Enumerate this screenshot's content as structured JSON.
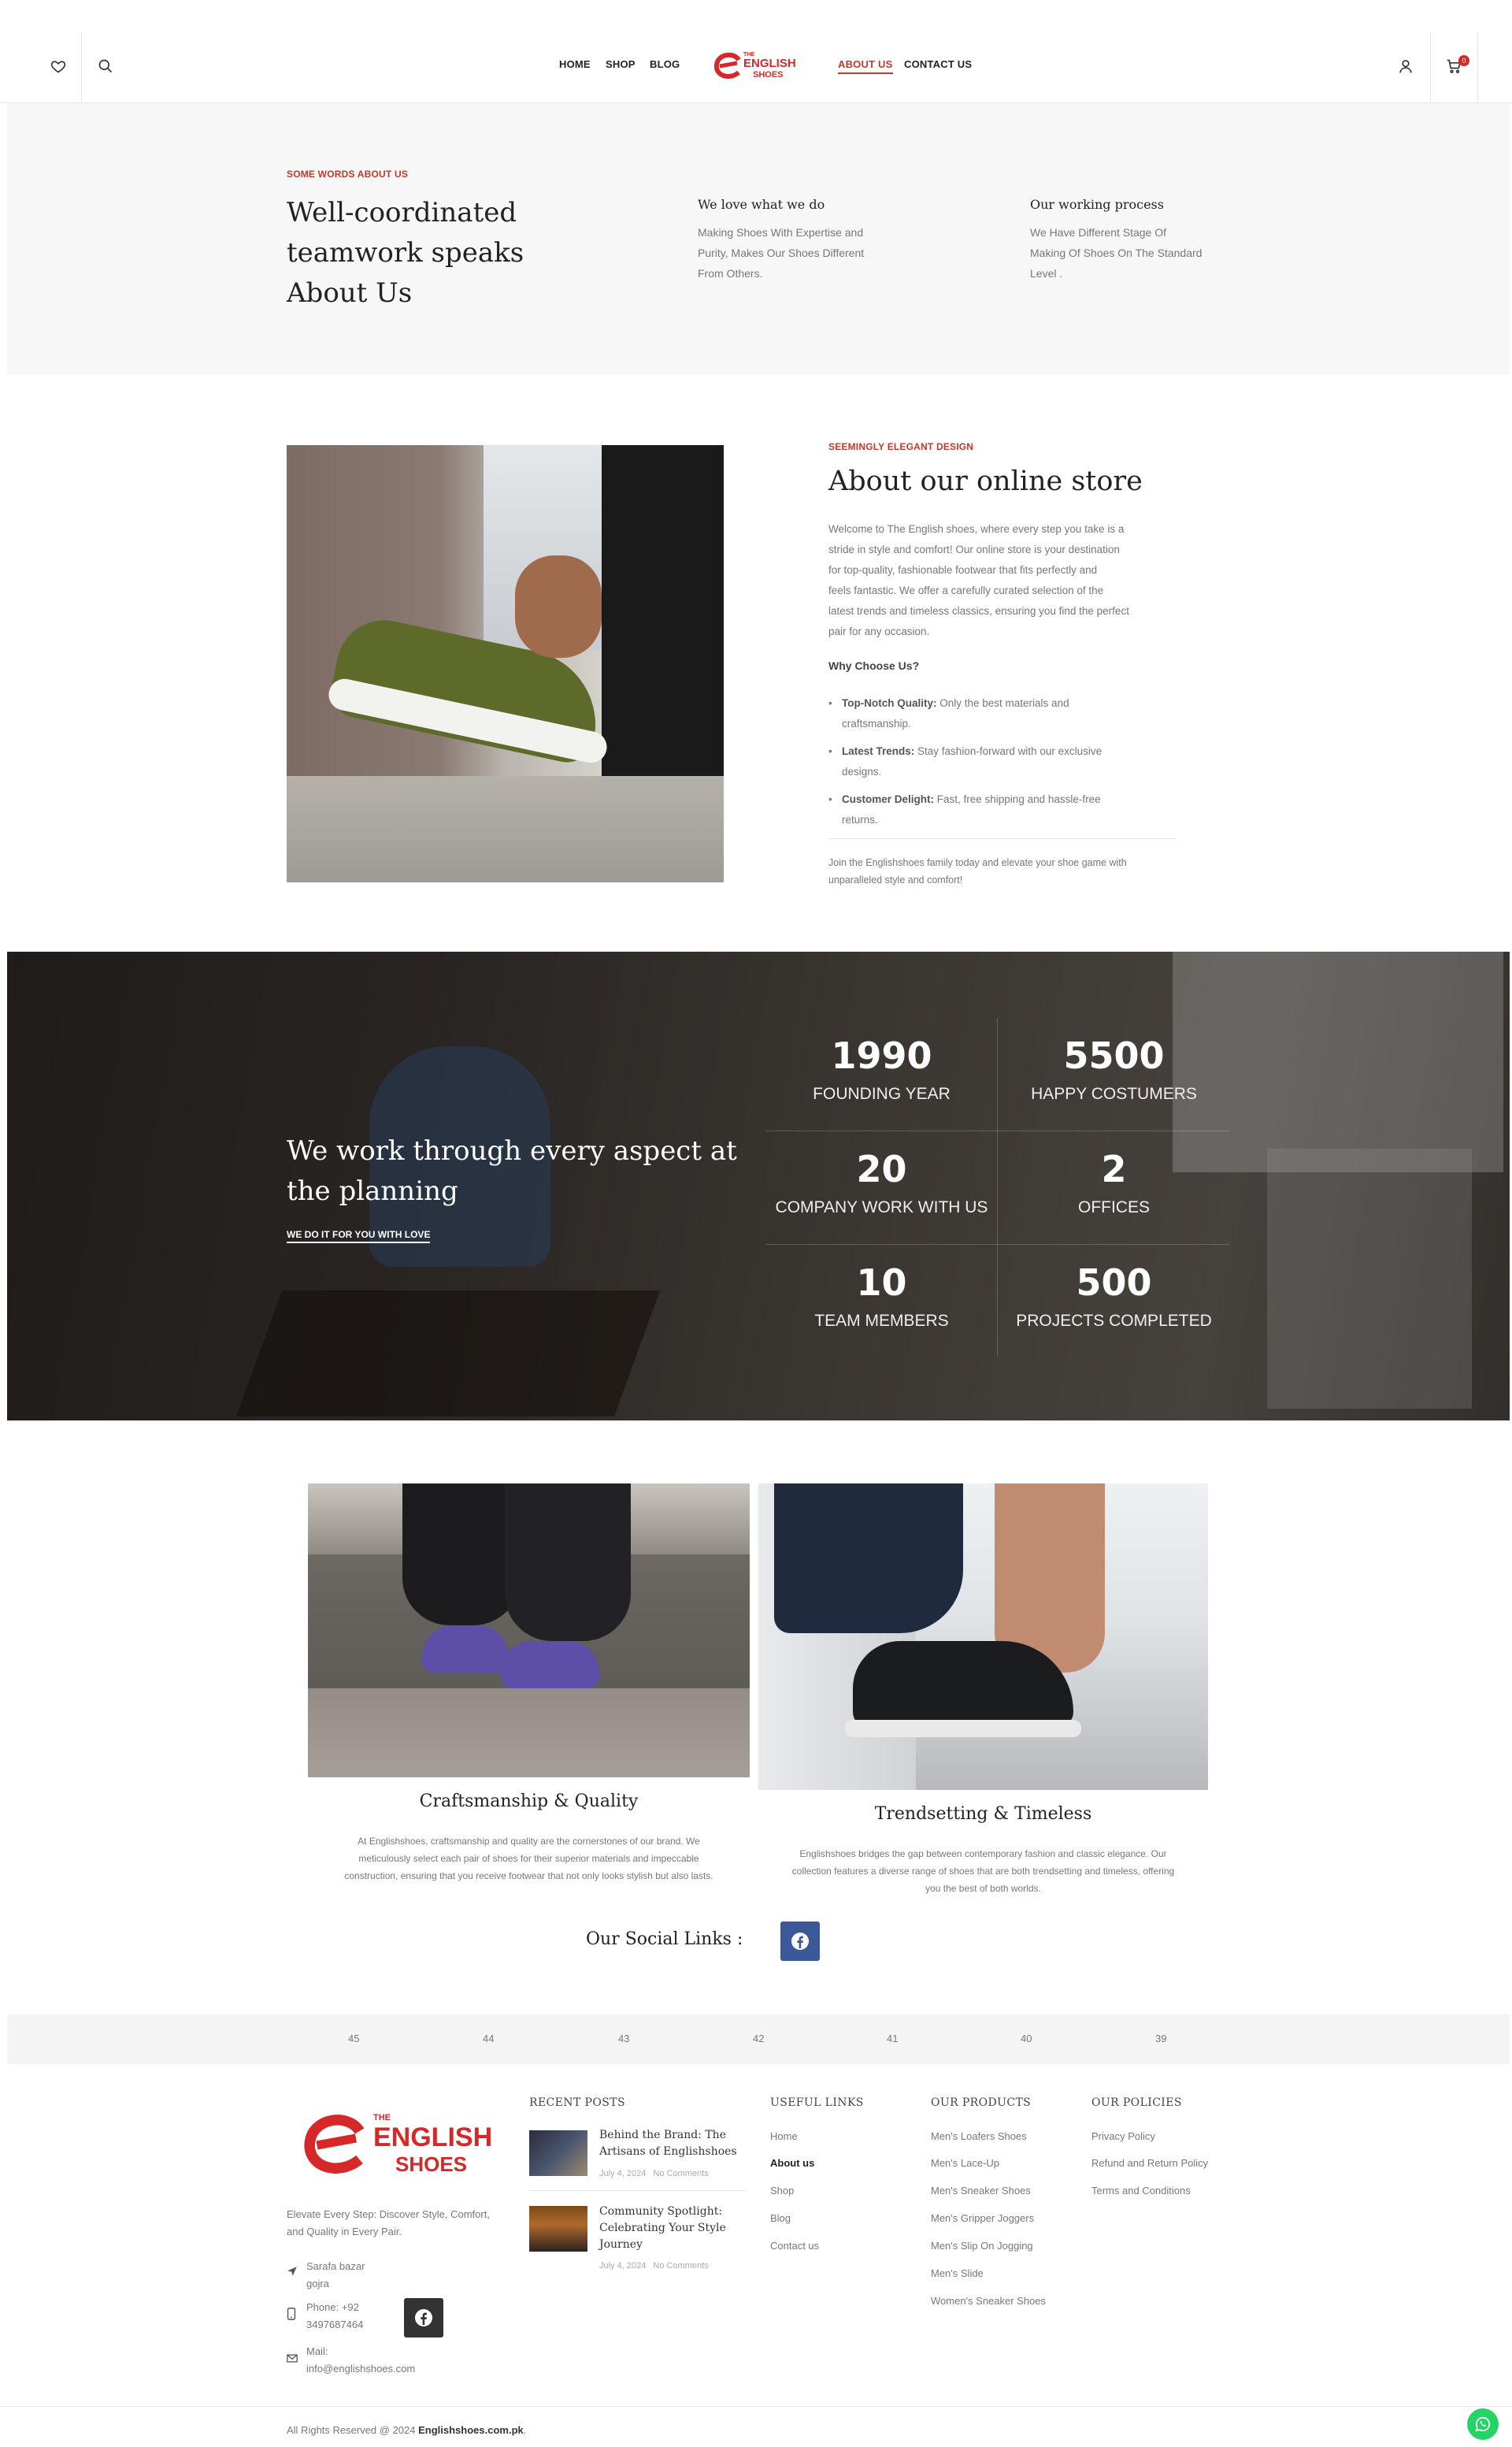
{
  "header": {
    "nav": [
      "HOME",
      "SHOP",
      "BLOG",
      "ABOUT US",
      "CONTACT US"
    ],
    "logo": {
      "small": "THE",
      "line1": "ENGLISH",
      "line2": "SHOES"
    },
    "cart_count": "0"
  },
  "intro": {
    "kicker": "SOME WORDS ABOUT US",
    "heading_lines": [
      "Well-coordinated",
      "teamwork speaks",
      "About Us"
    ],
    "col1_title": "We love what we do",
    "col1_lines": [
      "Making Shoes With Expertise and",
      "Purity, Makes Our Shoes Different",
      "From Others."
    ],
    "col2_title": "Our working process",
    "col2_lines": [
      "We Have Different Stage Of",
      "Making Of Shoes On The Standard",
      "Level ."
    ]
  },
  "about": {
    "kicker": "SEEMINGLY ELEGANT DESIGN",
    "title": "About our online store",
    "body_lines": [
      "Welcome to The English shoes, where every step you take is a",
      "stride in style and comfort! Our online store is your destination",
      "for top-quality, fashionable footwear that fits perfectly and",
      "feels fantastic. We offer a carefully curated selection of the",
      "latest trends and timeless classics, ensuring you find the perfect",
      "pair for any occasion."
    ],
    "why": "Why Choose Us?",
    "bullets": [
      {
        "label": "Top-Notch Quality:",
        "line1": " Only the best materials and",
        "line2": "craftsmanship."
      },
      {
        "label": "Latest Trends:",
        "line1": " Stay fashion-forward with our exclusive",
        "line2": "designs."
      },
      {
        "label": "Customer Delight:",
        "line1": " Fast, free shipping and hassle-free",
        "line2": "returns."
      }
    ],
    "closing_lines": [
      "Join the Englishshoes family today and elevate your shoe game with",
      "unparalleled style and comfort!"
    ]
  },
  "stats": {
    "heading_lines": [
      "We work through every aspect at",
      "the planning"
    ],
    "link": "WE DO IT FOR YOU WITH LOVE",
    "items": [
      {
        "num": "1990",
        "label": "FOUNDING YEAR"
      },
      {
        "num": "5500",
        "label": "HAPPY COSTUMERS"
      },
      {
        "num": "20",
        "label": "COMPANY WORK WITH US"
      },
      {
        "num": "2",
        "label": "OFFICES"
      },
      {
        "num": "10",
        "label": "TEAM MEMBERS"
      },
      {
        "num": "500",
        "label": "PROJECTS COMPLETED"
      }
    ]
  },
  "features": {
    "left_title": "Craftsmanship & Quality",
    "left_lines": [
      "At Englishshoes, craftsmanship and quality are the cornerstones of our brand. We",
      "meticulously select each pair of shoes for their superior materials and impeccable",
      "construction, ensuring that you receive footwear that not only looks stylish but also lasts."
    ],
    "right_title": "Trendsetting & Timeless",
    "right_lines": [
      "Englishshoes bridges the gap between contemporary fashion and classic elegance. Our",
      "collection features a diverse range of shoes that are both trendsetting and timeless, offering",
      "you the best of both worlds."
    ],
    "social_label": "Our Social Links :"
  },
  "strip_numbers": [
    "45",
    "44",
    "43",
    "42",
    "41",
    "40",
    "39"
  ],
  "footer": {
    "tagline_lines": [
      "Elevate Every Step: Discover Style, Comfort,",
      "and Quality in Every Pair."
    ],
    "address_lines": [
      "Sarafa bazar",
      "gojra"
    ],
    "phone_lines": [
      "Phone: +92",
      "3497687464"
    ],
    "mail_lines": [
      "Mail:",
      "info@englishshoes.com"
    ],
    "recent_posts_head": "RECENT POSTS",
    "posts": [
      {
        "title_lines": [
          "Behind the Brand: The",
          "Artisans of Englishshoes"
        ],
        "date": "July 4, 2024",
        "comments": "No Comments"
      },
      {
        "title_lines": [
          "Community Spotlight:",
          "Celebrating Your Style",
          "Journey"
        ],
        "date": "July 4, 2024",
        "comments": "No Comments"
      }
    ],
    "useful_head": "USEFUL LINKS",
    "useful_links": [
      "Home",
      "About us",
      "Shop",
      "Blog",
      "Contact us"
    ],
    "products_head": "OUR PRODUCTS",
    "products": [
      "Men's Loafers Shoes",
      "Men's Lace-Up",
      "Men's Sneaker Shoes",
      "Men's Gripper Joggers",
      "Men's Slip On Jogging",
      "Men's Slide",
      "Women's Sneaker Shoes"
    ],
    "policies_head": "OUR POLICIES",
    "policies": [
      "Privacy Policy",
      "Refund and Return Policy",
      "Terms and Conditions"
    ],
    "copyright": "All Rights Reserved @ 2024 ",
    "copyright_site": "Englishshoes.com.pk",
    "copyright_end": "."
  },
  "colors": {
    "accent": "#c0392b",
    "facebook": "#3b5998",
    "whatsapp": "#25d366"
  }
}
